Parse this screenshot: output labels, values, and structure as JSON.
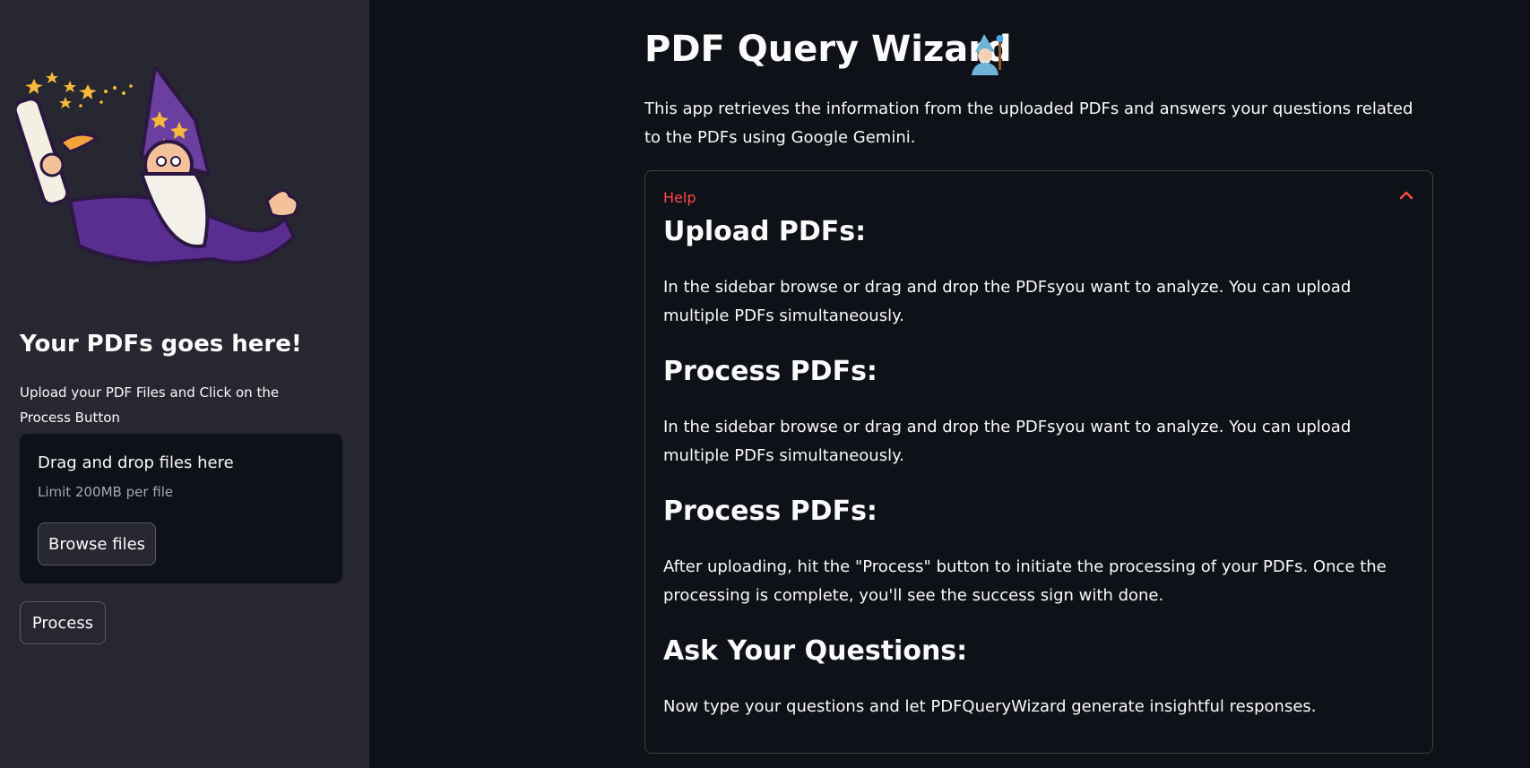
{
  "sidebar": {
    "title": "Your PDFs goes here!",
    "description": "Upload your PDF Files and Click on the Process Button",
    "uploader": {
      "drop_text": "Drag and drop files here",
      "limit_text": "Limit 200MB per file",
      "browse_label": "Browse files"
    },
    "process_label": "Process"
  },
  "main": {
    "title": "PDF Query Wizard",
    "title_icon": "mage-emoji-icon",
    "intro": "This app retrieves the information from the uploaded PDFs and answers your questions related to the PDFs using Google Gemini.",
    "help": {
      "label": "Help",
      "sections": [
        {
          "heading": "Upload PDFs:",
          "text": "In the sidebar browse or drag and drop the PDFsyou want to analyze. You can upload multiple PDFs simultaneously."
        },
        {
          "heading": "Process PDFs:",
          "text": "In the sidebar browse or drag and drop the PDFsyou want to analyze. You can upload multiple PDFs simultaneously."
        },
        {
          "heading": "Process PDFs:",
          "text": "After uploading, hit the \"Process\" button to initiate the processing of your PDFs. Once the processing is complete, you'll see the success sign with done."
        },
        {
          "heading": "Ask Your Questions:",
          "text": "Now type your questions and let PDFQueryWizard generate insightful responses."
        }
      ]
    }
  },
  "colors": {
    "background": "#0e1117",
    "sidebar": "#262730",
    "accent": "#ff4b4b",
    "text": "#fafafa"
  }
}
